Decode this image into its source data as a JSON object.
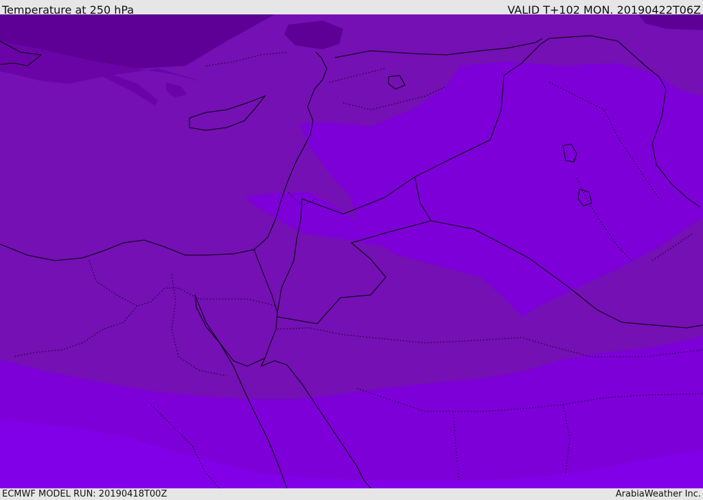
{
  "header": {
    "title": "Temperature at 250 hPa",
    "valid_time": "VALID T+102 MON. 20190422T06Z"
  },
  "footer": {
    "model_run": "ECMWF MODEL RUN: 20190418T00Z",
    "credit": "ArabiaWeather Inc."
  },
  "map": {
    "colors": {
      "darkest": "#5e0096",
      "dark": "#6a04a6",
      "medium": "#7410b4",
      "light": "#7d00d8",
      "brighter": "#8200e8",
      "brightest": "#8a00ff",
      "border_line": "#000000"
    }
  }
}
